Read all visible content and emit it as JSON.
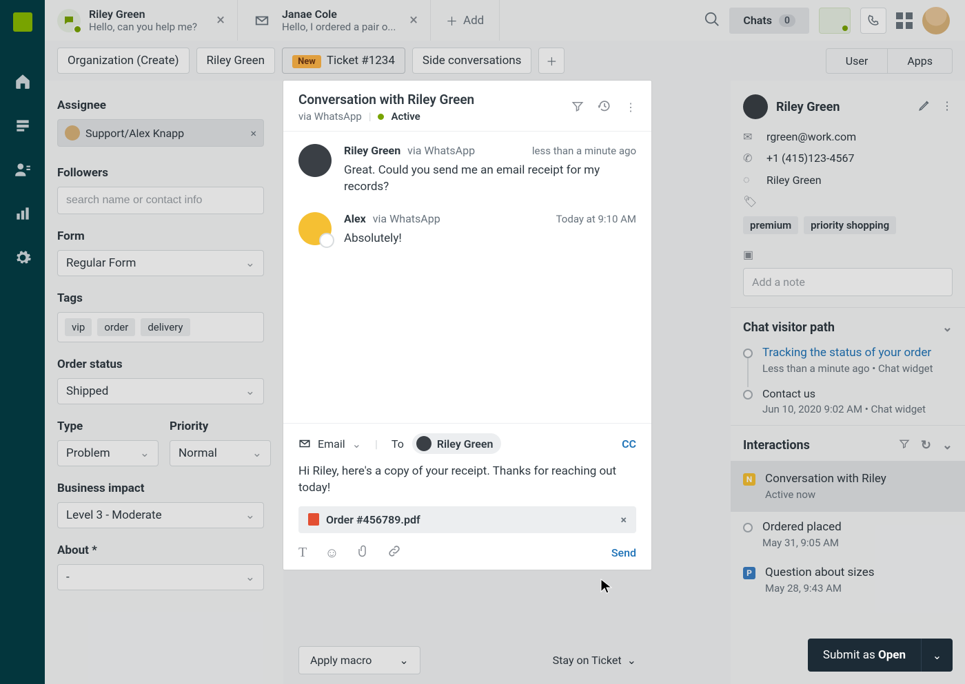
{
  "tabs": [
    {
      "title": "Riley Green",
      "sub": "Hello, can you help me?",
      "kind": "chat"
    },
    {
      "title": "Janae Cole",
      "sub": "Hello, I ordered a pair o...",
      "kind": "mail"
    }
  ],
  "add_tab": "Add",
  "chats_label": "Chats",
  "chats_count": "0",
  "sub_tabs": {
    "org": "Organization (Create)",
    "name": "Riley Green",
    "new": "New",
    "ticket": "Ticket #1234",
    "side": "Side conversations"
  },
  "user_apps": {
    "user": "User",
    "apps": "Apps"
  },
  "left": {
    "assignee_label": "Assignee",
    "assignee_value": "Support/Alex Knapp",
    "followers_label": "Followers",
    "followers_placeholder": "search name or contact info",
    "form_label": "Form",
    "form_value": "Regular Form",
    "tags_label": "Tags",
    "tags": [
      "vip",
      "order",
      "delivery"
    ],
    "order_status_label": "Order status",
    "order_status_value": "Shipped",
    "type_label": "Type",
    "type_value": "Problem",
    "priority_label": "Priority",
    "priority_value": "Normal",
    "impact_label": "Business impact",
    "impact_value": "Level 3 - Moderate",
    "about_label": "About *",
    "about_value": "-"
  },
  "right": {
    "name": "Riley Green",
    "email": "rgreen@work.com",
    "phone": "+1 (415)123-4567",
    "wa": "Riley Green",
    "tags": [
      "premium",
      "priority shopping"
    ],
    "note_placeholder": "Add a note",
    "path_title": "Chat visitor path",
    "path": [
      {
        "title": "Tracking the status of your order",
        "meta": "Less than a minute ago • Chat widget",
        "link": true
      },
      {
        "title": "Contact us",
        "meta": "Jun 10, 2020 9:02 AM • Chat widget",
        "link": false
      }
    ],
    "inter_title": "Interactions",
    "interactions": [
      {
        "badge": "N",
        "title": "Conversation with Riley",
        "meta": "Active now",
        "sel": true
      },
      {
        "badge": "",
        "title": "Ordered placed",
        "meta": "May 31, 9:05 AM"
      },
      {
        "badge": "P",
        "title": "Question about sizes",
        "meta": "May 28, 9:43 AM"
      }
    ]
  },
  "convo": {
    "title": "Conversation with Riley Green",
    "via": "via WhatsApp",
    "status": "Active",
    "messages": [
      {
        "name": "Riley Green",
        "via": "via WhatsApp",
        "ts": "less than a minute ago",
        "body": "Great. Could you send me an email receipt for my records?"
      },
      {
        "name": "Alex",
        "via": "via WhatsApp",
        "ts": "Today at 9:10 AM",
        "body": "Absolutely!"
      }
    ],
    "channel": "Email",
    "to_label": "To",
    "to_name": "Riley Green",
    "cc": "CC",
    "body": "Hi Riley, here's a copy of your receipt. Thanks for reaching out today!",
    "attachment": "Order #456789.pdf",
    "send": "Send"
  },
  "footer": {
    "macro": "Apply macro",
    "stay": "Stay on Ticket"
  },
  "submit": {
    "prefix": "Submit as ",
    "status": "Open"
  }
}
